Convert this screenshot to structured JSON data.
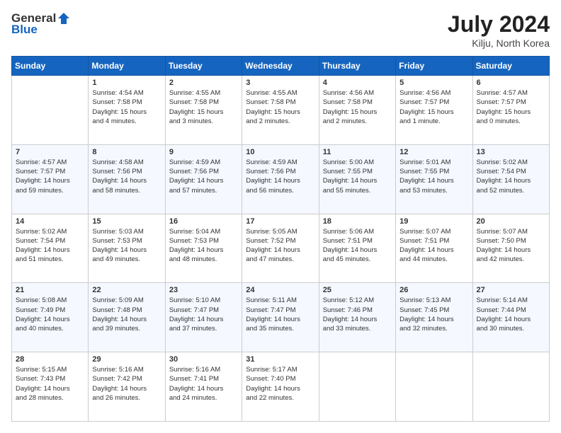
{
  "header": {
    "logo": {
      "general": "General",
      "blue": "Blue"
    },
    "title": "July 2024",
    "location": "Kilju, North Korea"
  },
  "days_of_week": [
    "Sunday",
    "Monday",
    "Tuesday",
    "Wednesday",
    "Thursday",
    "Friday",
    "Saturday"
  ],
  "weeks": [
    [
      {
        "day": "",
        "info": ""
      },
      {
        "day": "1",
        "info": "Sunrise: 4:54 AM\nSunset: 7:58 PM\nDaylight: 15 hours\nand 4 minutes."
      },
      {
        "day": "2",
        "info": "Sunrise: 4:55 AM\nSunset: 7:58 PM\nDaylight: 15 hours\nand 3 minutes."
      },
      {
        "day": "3",
        "info": "Sunrise: 4:55 AM\nSunset: 7:58 PM\nDaylight: 15 hours\nand 2 minutes."
      },
      {
        "day": "4",
        "info": "Sunrise: 4:56 AM\nSunset: 7:58 PM\nDaylight: 15 hours\nand 2 minutes."
      },
      {
        "day": "5",
        "info": "Sunrise: 4:56 AM\nSunset: 7:57 PM\nDaylight: 15 hours\nand 1 minute."
      },
      {
        "day": "6",
        "info": "Sunrise: 4:57 AM\nSunset: 7:57 PM\nDaylight: 15 hours\nand 0 minutes."
      }
    ],
    [
      {
        "day": "7",
        "info": "Sunrise: 4:57 AM\nSunset: 7:57 PM\nDaylight: 14 hours\nand 59 minutes."
      },
      {
        "day": "8",
        "info": "Sunrise: 4:58 AM\nSunset: 7:56 PM\nDaylight: 14 hours\nand 58 minutes."
      },
      {
        "day": "9",
        "info": "Sunrise: 4:59 AM\nSunset: 7:56 PM\nDaylight: 14 hours\nand 57 minutes."
      },
      {
        "day": "10",
        "info": "Sunrise: 4:59 AM\nSunset: 7:56 PM\nDaylight: 14 hours\nand 56 minutes."
      },
      {
        "day": "11",
        "info": "Sunrise: 5:00 AM\nSunset: 7:55 PM\nDaylight: 14 hours\nand 55 minutes."
      },
      {
        "day": "12",
        "info": "Sunrise: 5:01 AM\nSunset: 7:55 PM\nDaylight: 14 hours\nand 53 minutes."
      },
      {
        "day": "13",
        "info": "Sunrise: 5:02 AM\nSunset: 7:54 PM\nDaylight: 14 hours\nand 52 minutes."
      }
    ],
    [
      {
        "day": "14",
        "info": "Sunrise: 5:02 AM\nSunset: 7:54 PM\nDaylight: 14 hours\nand 51 minutes."
      },
      {
        "day": "15",
        "info": "Sunrise: 5:03 AM\nSunset: 7:53 PM\nDaylight: 14 hours\nand 49 minutes."
      },
      {
        "day": "16",
        "info": "Sunrise: 5:04 AM\nSunset: 7:53 PM\nDaylight: 14 hours\nand 48 minutes."
      },
      {
        "day": "17",
        "info": "Sunrise: 5:05 AM\nSunset: 7:52 PM\nDaylight: 14 hours\nand 47 minutes."
      },
      {
        "day": "18",
        "info": "Sunrise: 5:06 AM\nSunset: 7:51 PM\nDaylight: 14 hours\nand 45 minutes."
      },
      {
        "day": "19",
        "info": "Sunrise: 5:07 AM\nSunset: 7:51 PM\nDaylight: 14 hours\nand 44 minutes."
      },
      {
        "day": "20",
        "info": "Sunrise: 5:07 AM\nSunset: 7:50 PM\nDaylight: 14 hours\nand 42 minutes."
      }
    ],
    [
      {
        "day": "21",
        "info": "Sunrise: 5:08 AM\nSunset: 7:49 PM\nDaylight: 14 hours\nand 40 minutes."
      },
      {
        "day": "22",
        "info": "Sunrise: 5:09 AM\nSunset: 7:48 PM\nDaylight: 14 hours\nand 39 minutes."
      },
      {
        "day": "23",
        "info": "Sunrise: 5:10 AM\nSunset: 7:47 PM\nDaylight: 14 hours\nand 37 minutes."
      },
      {
        "day": "24",
        "info": "Sunrise: 5:11 AM\nSunset: 7:47 PM\nDaylight: 14 hours\nand 35 minutes."
      },
      {
        "day": "25",
        "info": "Sunrise: 5:12 AM\nSunset: 7:46 PM\nDaylight: 14 hours\nand 33 minutes."
      },
      {
        "day": "26",
        "info": "Sunrise: 5:13 AM\nSunset: 7:45 PM\nDaylight: 14 hours\nand 32 minutes."
      },
      {
        "day": "27",
        "info": "Sunrise: 5:14 AM\nSunset: 7:44 PM\nDaylight: 14 hours\nand 30 minutes."
      }
    ],
    [
      {
        "day": "28",
        "info": "Sunrise: 5:15 AM\nSunset: 7:43 PM\nDaylight: 14 hours\nand 28 minutes."
      },
      {
        "day": "29",
        "info": "Sunrise: 5:16 AM\nSunset: 7:42 PM\nDaylight: 14 hours\nand 26 minutes."
      },
      {
        "day": "30",
        "info": "Sunrise: 5:16 AM\nSunset: 7:41 PM\nDaylight: 14 hours\nand 24 minutes."
      },
      {
        "day": "31",
        "info": "Sunrise: 5:17 AM\nSunset: 7:40 PM\nDaylight: 14 hours\nand 22 minutes."
      },
      {
        "day": "",
        "info": ""
      },
      {
        "day": "",
        "info": ""
      },
      {
        "day": "",
        "info": ""
      }
    ]
  ]
}
